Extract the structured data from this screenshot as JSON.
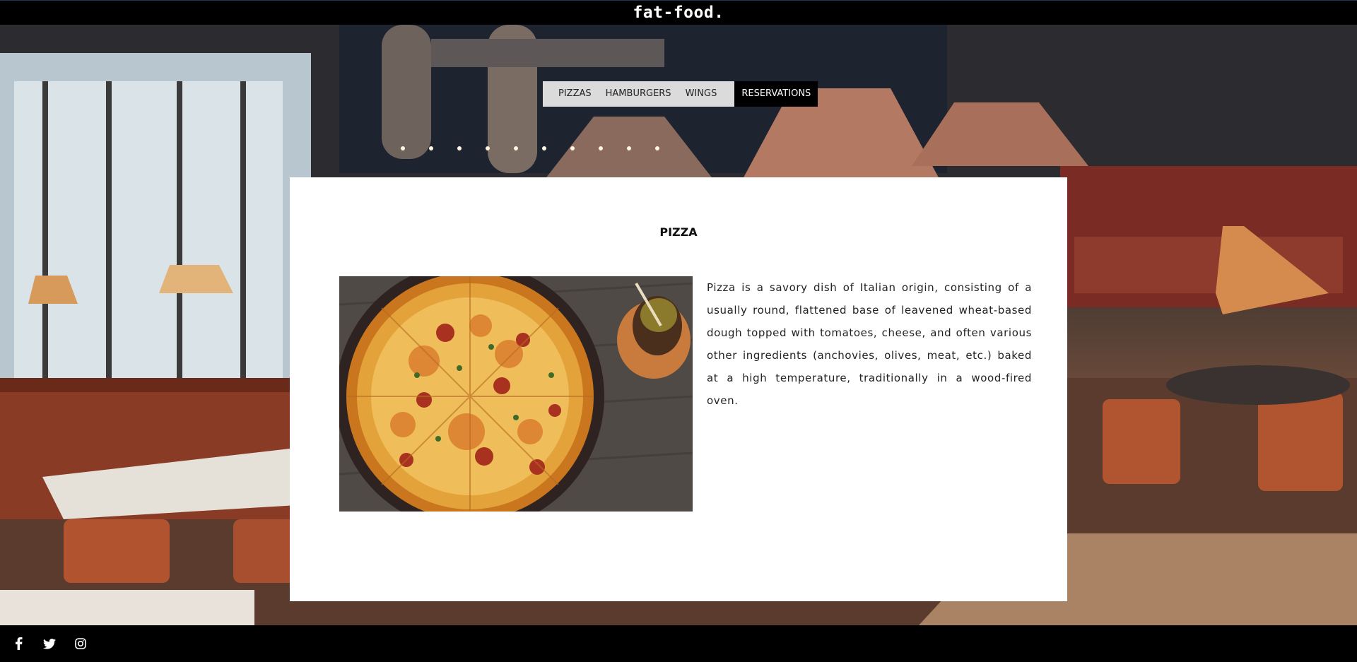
{
  "brand": {
    "name": "fat-food."
  },
  "nav": {
    "items": [
      {
        "label": "PIZZAS"
      },
      {
        "label": "HAMBURGERS"
      },
      {
        "label": "WINGS"
      },
      {
        "label": "RESERVATIONS",
        "active": true
      }
    ]
  },
  "card": {
    "title": "PIZZA",
    "image_icon": "pizza-photo",
    "description": "Pizza is a savory dish of Italian origin, consisting of a usually round, flattened base of leavened wheat-based dough topped with tomatoes, cheese, and often various other ingredients (anchovies, olives, meat, etc.) baked at a high temperature, traditionally in a wood-fired oven."
  },
  "footer": {
    "social_icons": [
      "facebook-icon",
      "twitter-icon",
      "instagram-icon"
    ]
  },
  "colors": {
    "header_bg": "#000000",
    "nav_bg": "#ebebeb",
    "nav_active_bg": "#000000",
    "card_bg": "#ffffff",
    "footer_bg": "#000000"
  }
}
